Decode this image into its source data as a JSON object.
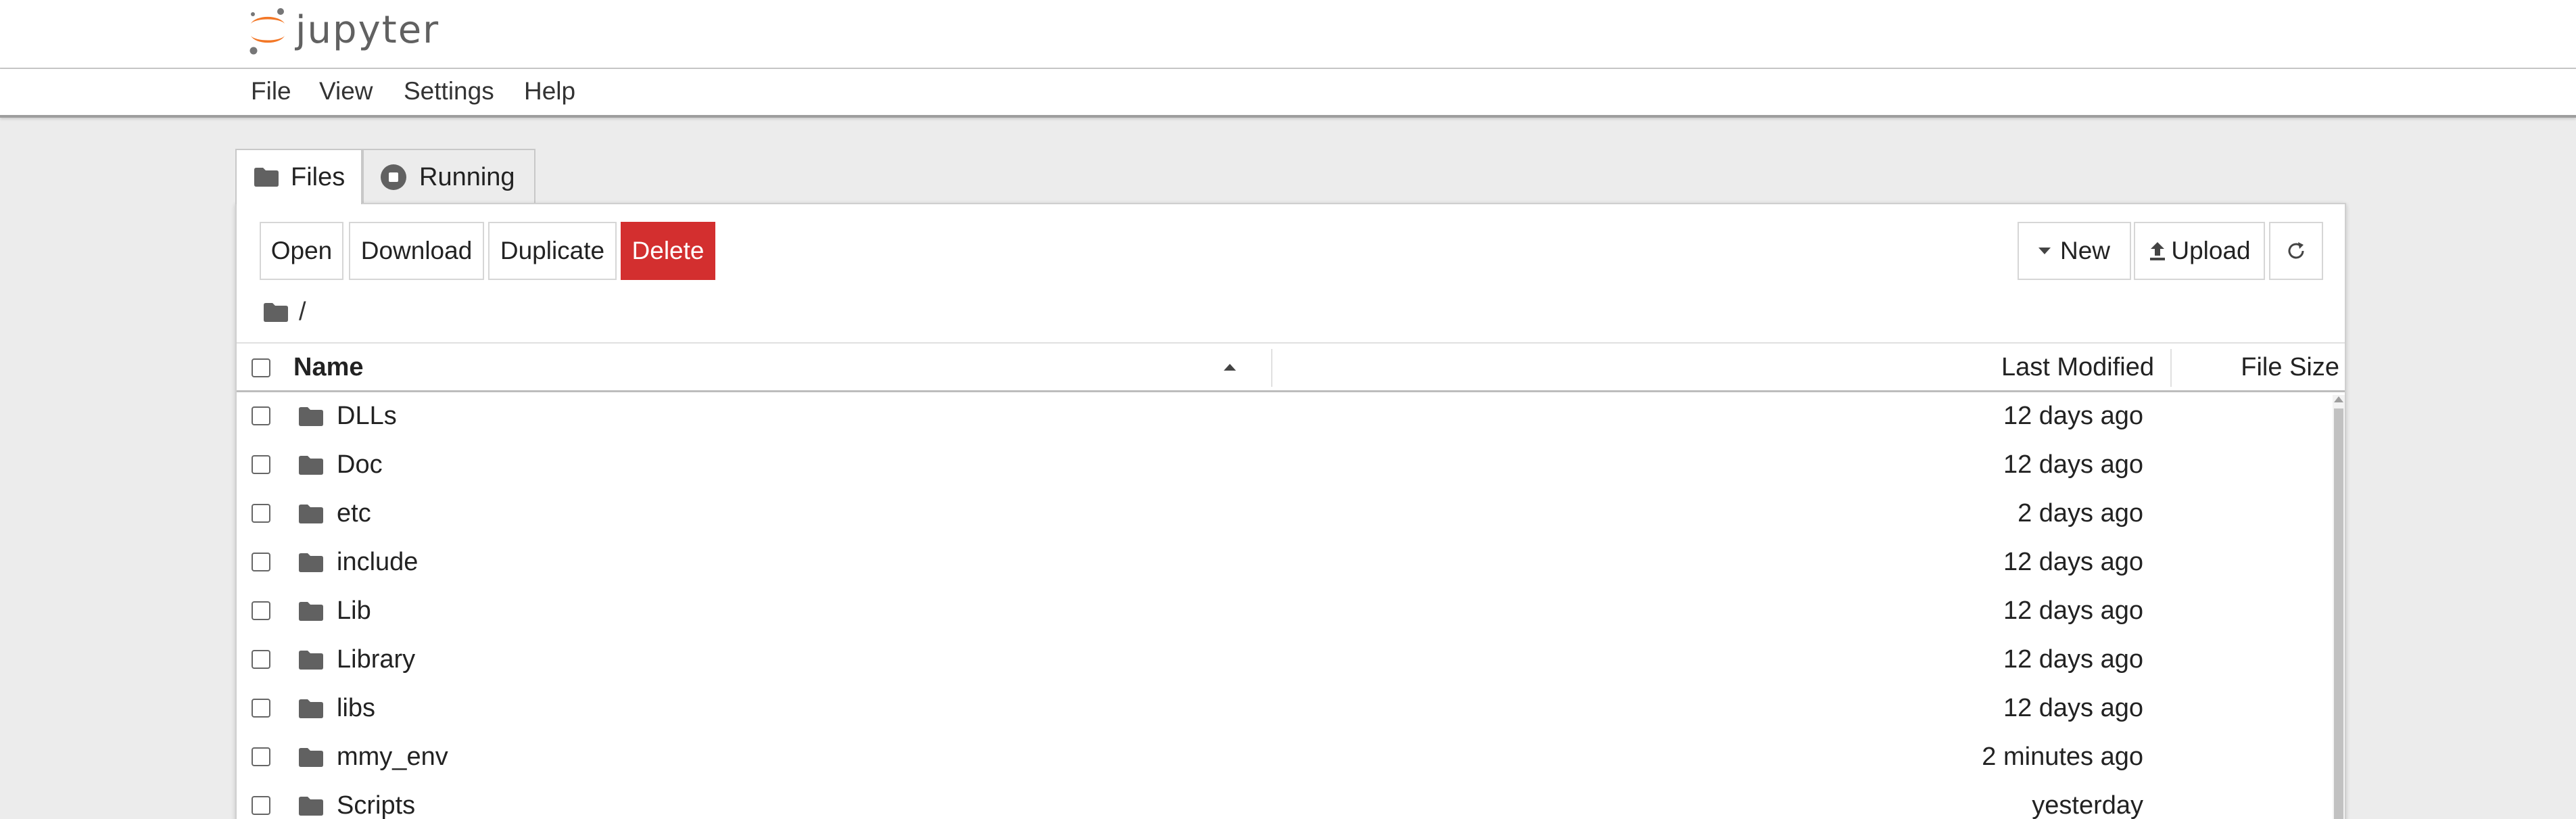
{
  "app": {
    "logo_text": "jupyter",
    "brand_color": "#f37726",
    "logo_dot_color": "#767677"
  },
  "menu": [
    "File",
    "View",
    "Settings",
    "Help"
  ],
  "tabs": [
    {
      "label": "Files",
      "icon": "folder-icon",
      "active": true
    },
    {
      "label": "Running",
      "icon": "running-icon",
      "active": false
    }
  ],
  "toolbar": {
    "open": "Open",
    "download": "Download",
    "duplicate": "Duplicate",
    "delete": "Delete",
    "new": "New",
    "upload": "Upload",
    "refresh_icon": "refresh-icon",
    "delete_color": "#d32f2f"
  },
  "breadcrumb": {
    "path": "/"
  },
  "table": {
    "columns": {
      "name": "Name",
      "modified": "Last Modified",
      "size": "File Size"
    },
    "sort": {
      "column": "name",
      "direction": "ascending"
    },
    "rows": [
      {
        "name": "DLLs",
        "modified": "12 days ago",
        "type": "folder"
      },
      {
        "name": "Doc",
        "modified": "12 days ago",
        "type": "folder"
      },
      {
        "name": "etc",
        "modified": "2 days ago",
        "type": "folder"
      },
      {
        "name": "include",
        "modified": "12 days ago",
        "type": "folder"
      },
      {
        "name": "Lib",
        "modified": "12 days ago",
        "type": "folder"
      },
      {
        "name": "Library",
        "modified": "12 days ago",
        "type": "folder"
      },
      {
        "name": "libs",
        "modified": "12 days ago",
        "type": "folder"
      },
      {
        "name": "mmy_env",
        "modified": "2 minutes ago",
        "type": "folder"
      },
      {
        "name": "Scripts",
        "modified": "yesterday",
        "type": "folder"
      }
    ]
  }
}
